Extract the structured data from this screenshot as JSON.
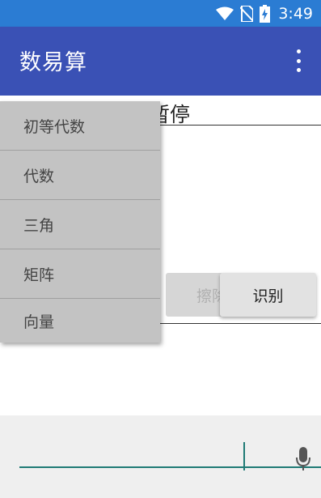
{
  "status_bar": {
    "time": "3:49",
    "icons": [
      "wifi-icon",
      "no-sim-icon",
      "battery-charging-icon"
    ],
    "color": "#2b7cd3"
  },
  "app_bar": {
    "title": "数易算",
    "menu_icon": "overflow-menu-icon",
    "color": "#3a51b5"
  },
  "main": {
    "pause_label": "暂停",
    "erase_label": "擦除",
    "recognize_label": "识别"
  },
  "dropdown": {
    "items": [
      {
        "label": "初等代数"
      },
      {
        "label": "代数"
      },
      {
        "label": "三角"
      },
      {
        "label": "矩阵"
      },
      {
        "label": "向量"
      }
    ]
  },
  "input": {
    "value": "",
    "mic_icon": "microphone-icon",
    "accent": "#1f7a75"
  }
}
